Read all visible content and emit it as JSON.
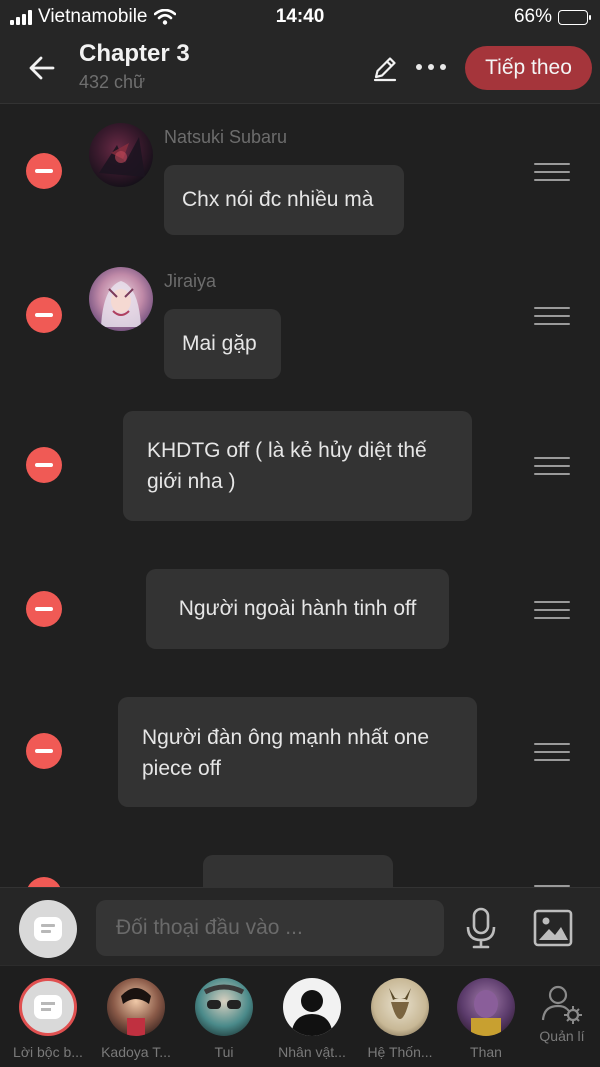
{
  "status_bar": {
    "carrier": "Vietnamobile",
    "time": "14:40",
    "battery_percent": "66%",
    "battery_level": 0.66,
    "battery_color": "#f1c40f"
  },
  "header": {
    "back_icon": "arrow-left-icon",
    "title": "Chapter 3",
    "subtitle": "432 chữ",
    "edit_icon": "pencil-icon",
    "more_icon": "more-dots-icon",
    "next_label": "Tiếp theo",
    "next_color": "#a5353b"
  },
  "messages": [
    {
      "speaker": "Natsuki Subaru",
      "text": "Chx nói đc nhiều mà",
      "has_avatar": true
    },
    {
      "speaker": "Jiraiya",
      "text": "Mai gặp",
      "has_avatar": true
    },
    {
      "speaker": "",
      "text": "KHDTG off ( là kẻ hủy diệt thế giới nha )",
      "has_avatar": false
    },
    {
      "speaker": "",
      "text": "Người ngoài hành tinh off",
      "has_avatar": false
    },
    {
      "speaker": "",
      "text": "Người đàn ông mạnh nhất one piece off",
      "has_avatar": false
    }
  ],
  "input_bar": {
    "placeholder": "Đối thoại đầu vào ...",
    "mic_icon": "microphone-icon",
    "image_icon": "image-icon"
  },
  "characters": [
    {
      "label": "Lời bộc b...",
      "icon": "narration-chat-icon",
      "selected": true
    },
    {
      "label": "Kadoya T...",
      "icon": "avatar"
    },
    {
      "label": "Tui",
      "icon": "avatar"
    },
    {
      "label": "Nhân vật...",
      "icon": "silhouette-avatar"
    },
    {
      "label": "Hệ Thốn...",
      "icon": "avatar"
    },
    {
      "label": "Than",
      "icon": "avatar"
    },
    {
      "label": "Quản lí",
      "icon": "manage-user-gear-icon"
    }
  ],
  "colors": {
    "delete_red": "#f05a55",
    "bubble_bg": "#333333",
    "background": "#202020"
  }
}
